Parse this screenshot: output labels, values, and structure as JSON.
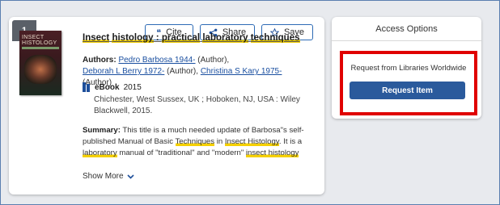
{
  "result": {
    "index": "1",
    "actions": {
      "cite": "Cite",
      "share": "Share",
      "save": "Save"
    },
    "title_parts": [
      "Insect",
      " ",
      "histology",
      " : ",
      "practical",
      " ",
      "laboratory",
      " ",
      "techniques"
    ],
    "cover_text": "INSECT HISTOLOGY",
    "authors_label": "Authors:",
    "authors": [
      {
        "name": "Pedro Barbosa 1944-",
        "role": " (Author),"
      },
      {
        "name": "Deborah L Berry 1972-",
        "role": " (Author),"
      },
      {
        "name": "Christina S Kary 1975-",
        "role": " (Author)"
      }
    ],
    "format": "eBook",
    "year": "2015",
    "publication": "Chichester, West Sussex, UK ; Hoboken, NJ, USA : Wiley Blackwell, 2015.",
    "summary_label": "Summary:",
    "summary": {
      "s1": "This title is a much needed update of Barbosa\"s self-published Manual of Basic ",
      "h1": "Techniques",
      "s2": " in ",
      "h2": "Insect Histology",
      "s3": ". It is a ",
      "h3": "laboratory",
      "s4": " manual of \"traditional\" and \"modern\" ",
      "h4": "insect histology"
    },
    "show_more": "Show More"
  },
  "access": {
    "title": "Access Options",
    "request_text": "Request from Libraries Worldwide",
    "request_button": "Request Item"
  },
  "colors": {
    "accent": "#2a5a9c",
    "highlight": "#f5d000",
    "callout": "#e00000"
  }
}
